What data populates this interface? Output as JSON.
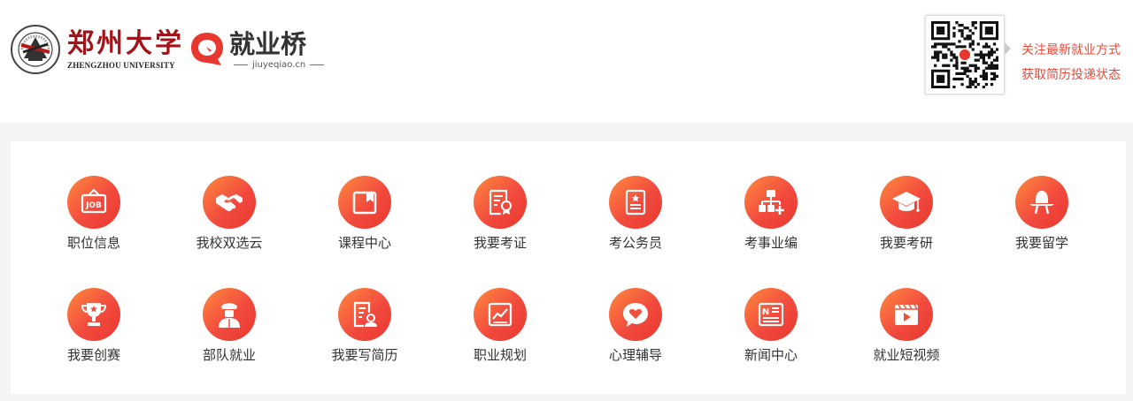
{
  "header": {
    "zzu_name_cn": "郑州大学",
    "zzu_name_en": "ZHENGZHOU UNIVERSITY",
    "jyq_name": "就业桥",
    "jyq_url": "jiuyeqiao.cn",
    "qr_tip_line1": "关注最新就业方式",
    "qr_tip_line2": "获取简历投递状态"
  },
  "menu": {
    "items": [
      {
        "label": "职位信息",
        "icon": "job-sign-icon"
      },
      {
        "label": "我校双选云",
        "icon": "handshake-icon"
      },
      {
        "label": "课程中心",
        "icon": "course-book-icon"
      },
      {
        "label": "我要考证",
        "icon": "certificate-icon"
      },
      {
        "label": "考公务员",
        "icon": "civil-service-icon"
      },
      {
        "label": "考事业编",
        "icon": "org-chart-icon"
      },
      {
        "label": "我要考研",
        "icon": "graduation-cap-icon"
      },
      {
        "label": "我要留学",
        "icon": "study-abroad-icon"
      },
      {
        "label": "我要创赛",
        "icon": "trophy-icon"
      },
      {
        "label": "部队就业",
        "icon": "soldier-icon"
      },
      {
        "label": "我要写简历",
        "icon": "resume-icon"
      },
      {
        "label": "职业规划",
        "icon": "career-chart-icon"
      },
      {
        "label": "心理辅导",
        "icon": "heart-chat-icon"
      },
      {
        "label": "新闻中心",
        "icon": "newspaper-icon"
      },
      {
        "label": "就业短视频",
        "icon": "video-icon"
      }
    ]
  },
  "colors": {
    "icon_gradient_start": "#ff8a3d",
    "icon_gradient_end": "#e8382f",
    "tip_text": "#e84a3a",
    "zzu_red": "#a3141a"
  }
}
